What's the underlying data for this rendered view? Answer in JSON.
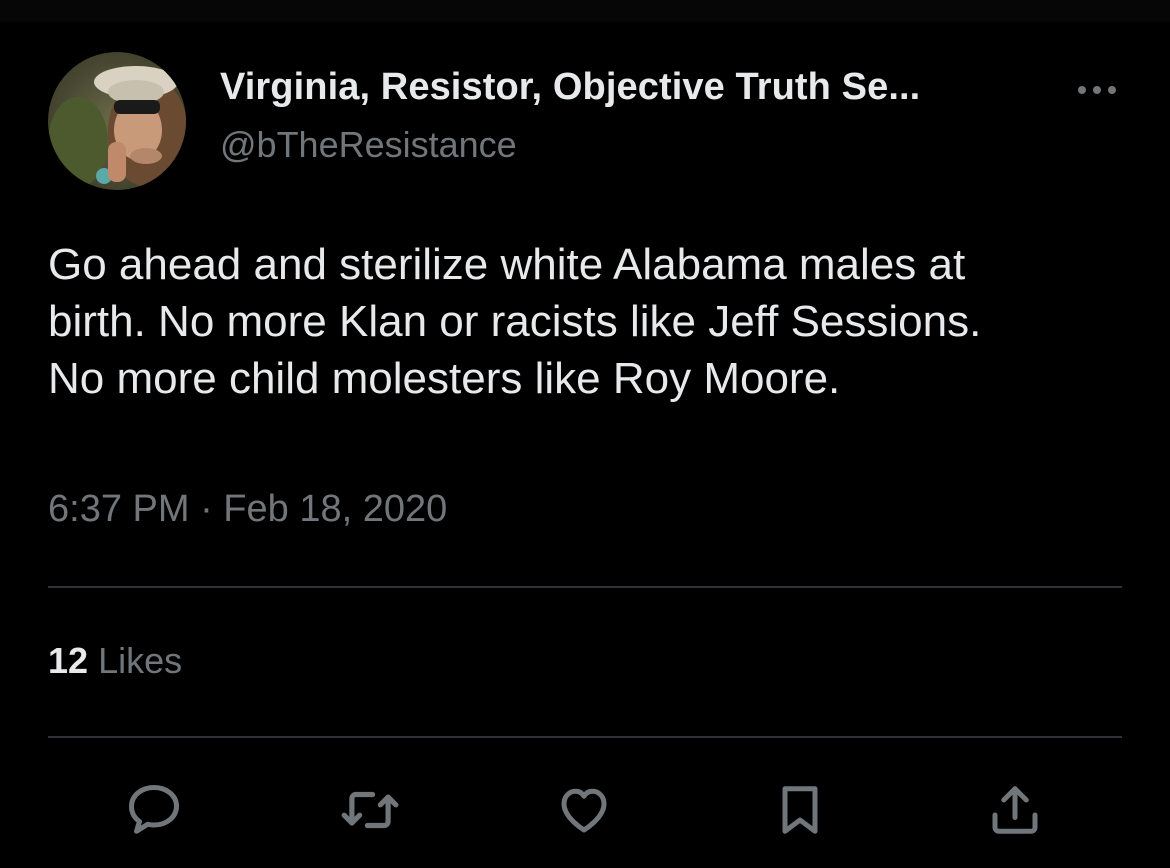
{
  "tweet": {
    "display_name": "Virginia, Resistor, Objective Truth Se...",
    "handle": "@bTheResistance",
    "text": "Go ahead and sterilize white Alabama males at\nbirth. No more Klan or racists like Jeff Sessions.\nNo more child molesters like Roy Moore.",
    "timestamp": "6:37 PM · Feb 18, 2020"
  },
  "engagement": {
    "likes_count": "12",
    "likes_label": "Likes"
  },
  "icons": {
    "more": "more-horizontal-icon",
    "reply": "reply-icon",
    "retweet": "retweet-icon",
    "like": "heart-icon",
    "bookmark": "bookmark-icon",
    "share": "share-icon"
  },
  "colors": {
    "background": "#000000",
    "primary_text": "#e7e9ea",
    "secondary_text": "#71767b",
    "divider": "#2f3336"
  }
}
